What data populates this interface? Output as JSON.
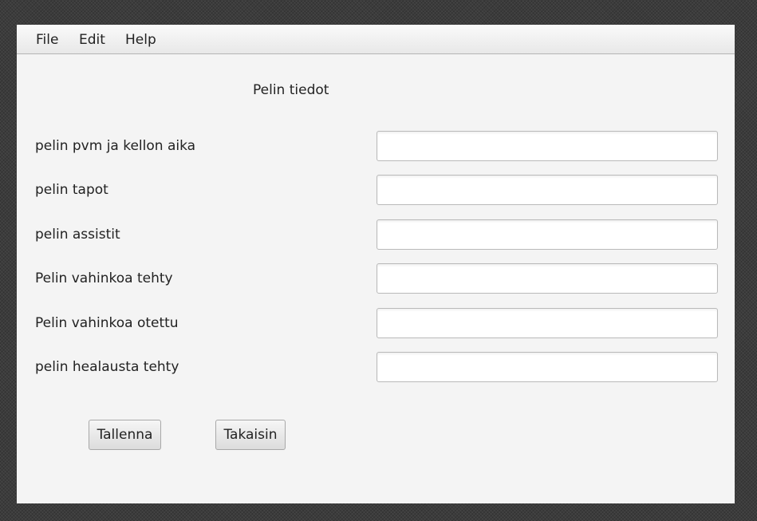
{
  "menu": {
    "items": [
      {
        "label": "File"
      },
      {
        "label": "Edit"
      },
      {
        "label": "Help"
      }
    ]
  },
  "form": {
    "title": "Pelin tiedot",
    "fields": [
      {
        "label": "pelin pvm ja kellon aika",
        "value": ""
      },
      {
        "label": "pelin tapot",
        "value": ""
      },
      {
        "label": "pelin assistit",
        "value": ""
      },
      {
        "label": "Pelin vahinkoa tehty",
        "value": ""
      },
      {
        "label": "Pelin vahinkoa otettu",
        "value": ""
      },
      {
        "label": "pelin healausta tehty",
        "value": ""
      }
    ],
    "buttons": {
      "save": "Tallenna",
      "back": "Takaisin"
    }
  }
}
